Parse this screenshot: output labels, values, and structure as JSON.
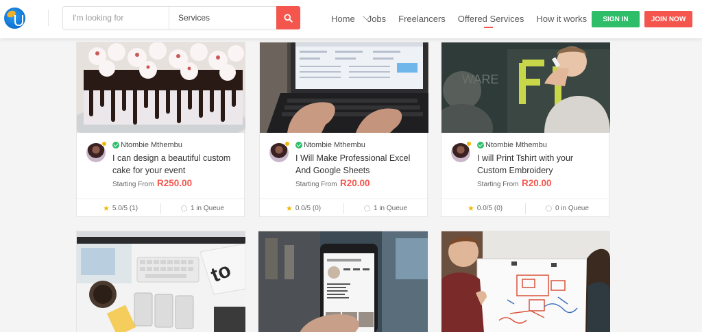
{
  "header": {
    "search": {
      "placeholder": "I'm looking for",
      "category": "Services"
    },
    "nav": [
      {
        "label": "Home"
      },
      {
        "label": "Jobs"
      },
      {
        "label": "Freelancers"
      },
      {
        "label": "Offered Services",
        "active": true
      },
      {
        "label": "How it works"
      }
    ],
    "signin_label": "SIGN IN",
    "join_label": "JOIN NOW"
  },
  "cards": [
    {
      "image": "cake-photo",
      "seller": "Ntombie Mthembu",
      "title": "I can design a beautiful custom cake for your event",
      "price_label": "Starting From",
      "price": "R250.00",
      "rating": "5.0/5 (1)",
      "queue": "1 in Queue"
    },
    {
      "image": "laptop-typing-photo",
      "seller": "Ntombie Mthembu",
      "title": "I Will Make Professional Excel And Google Sheets",
      "price_label": "Starting From",
      "price": "R20.00",
      "rating": "0.0/5 (0)",
      "queue": "1 in Queue"
    },
    {
      "image": "whiteboard-writing-photo",
      "seller": "Ntombie Mthembu",
      "title": "I will Print Tshirt with your Custom Embroidery",
      "price_label": "Starting From",
      "price": "R20.00",
      "rating": "0.0/5 (0)",
      "queue": "0 in Queue"
    },
    {
      "image": "desk-workspace-photo"
    },
    {
      "image": "phone-app-photo"
    },
    {
      "image": "whiteboard-sketch-photo"
    }
  ],
  "colors": {
    "accent": "#f4564d",
    "green": "#2ebe6a",
    "star": "#f2b705"
  }
}
